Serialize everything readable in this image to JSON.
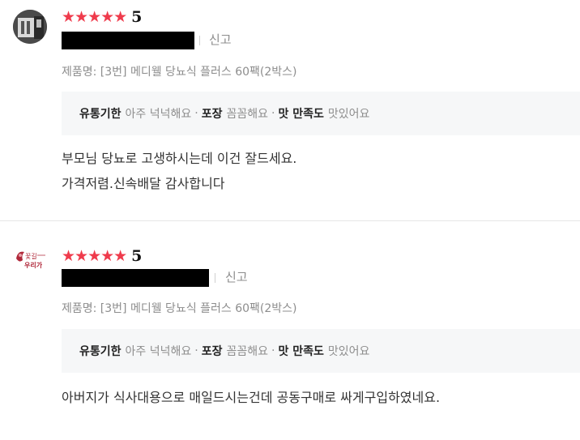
{
  "reviews": [
    {
      "stars": "★★★★★",
      "score": "5",
      "report": "신고",
      "product": "제품명: [3번] 메디웰 당뇨식 플러스 60팩(2박스)",
      "attrs": [
        {
          "key": "유통기한",
          "value": "아주 넉넉해요"
        },
        {
          "key": "포장",
          "value": "꼼꼼해요"
        },
        {
          "key": "맛 만족도",
          "value": "맛있어요"
        }
      ],
      "body": [
        "부모님 당뇨로 고생하시는데 이건 잘드세요.",
        "가격저렴.신속배달 감사합니다"
      ]
    },
    {
      "stars": "★★★★★",
      "score": "5",
      "report": "신고",
      "avatar_text": [
        "꽃길",
        "우리가"
      ],
      "product": "제품명: [3번] 메디웰 당뇨식 플러스 60팩(2박스)",
      "attrs": [
        {
          "key": "유통기한",
          "value": "아주 넉넉해요"
        },
        {
          "key": "포장",
          "value": "꼼꼼해요"
        },
        {
          "key": "맛 만족도",
          "value": "맛있어요"
        }
      ],
      "body": [
        "아버지가 식사대용으로 매일드시는건데 공동구매로 싸게구입하였네요."
      ]
    }
  ],
  "colors": {
    "star": "#ef3b4c",
    "muted": "#8d8d8d",
    "attr_bg": "#f6f7f8",
    "divider": "#e6e6e6"
  }
}
